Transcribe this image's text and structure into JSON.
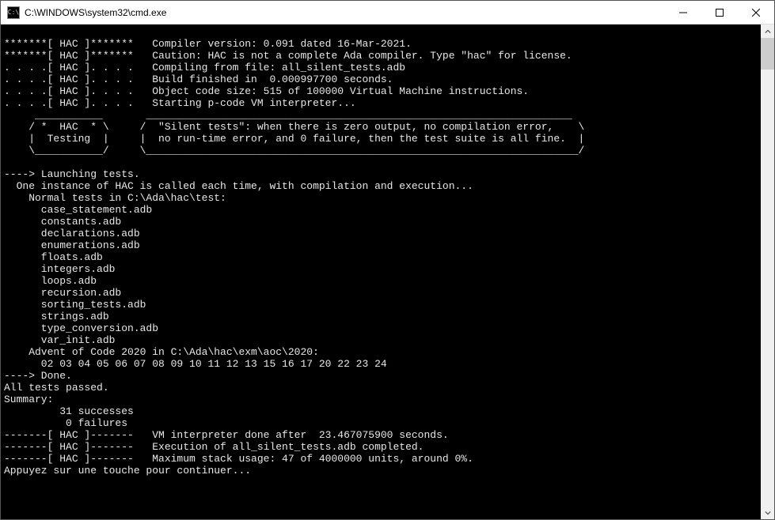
{
  "window": {
    "title": "C:\\WINDOWS\\system32\\cmd.exe",
    "icon_label": "C:\\"
  },
  "terminal": {
    "lines": [
      "",
      "*******[ HAC ]*******   Compiler version: 0.091 dated 16-Mar-2021.",
      "*******[ HAC ]*******   Caution: HAC is not a complete Ada compiler. Type \"hac\" for license.",
      ". . . .[ HAC ]. . . .   Compiling from file: all_silent_tests.adb",
      ". . . .[ HAC ]. . . .   Build finished in  0.000997700 seconds.",
      ". . . .[ HAC ]. . . .   Object code size: 515 of 100000 Virtual Machine instructions.",
      ". . . .[ HAC ]. . . .   Starting p-code VM interpreter...",
      "     ___________       _____________________________________________________________________",
      "    / *  HAC  * \\     /  \"Silent tests\": when there is zero output, no compilation error,    \\",
      "    |  Testing  |     |  no run-time error, and 0 failure, then the test suite is all fine.  |",
      "    \\___________/     \\______________________________________________________________________/",
      "",
      "----> Launching tests.",
      "  One instance of HAC is called each time, with compilation and execution...",
      "    Normal tests in C:\\Ada\\hac\\test:",
      "      case_statement.adb",
      "      constants.adb",
      "      declarations.adb",
      "      enumerations.adb",
      "      floats.adb",
      "      integers.adb",
      "      loops.adb",
      "      recursion.adb",
      "      sorting_tests.adb",
      "      strings.adb",
      "      type_conversion.adb",
      "      var_init.adb",
      "    Advent of Code 2020 in C:\\Ada\\hac\\exm\\aoc\\2020:",
      "      02 03 04 05 06 07 08 09 10 11 12 13 15 16 17 20 22 23 24",
      "----> Done.",
      "All tests passed.",
      "Summary:",
      "         31 successes",
      "          0 failures",
      "-------[ HAC ]-------   VM interpreter done after  23.467075900 seconds.",
      "-------[ HAC ]-------   Execution of all_silent_tests.adb completed.",
      "-------[ HAC ]-------   Maximum stack usage: 47 of 4000000 units, around 0%.",
      "Appuyez sur une touche pour continuer..."
    ]
  }
}
